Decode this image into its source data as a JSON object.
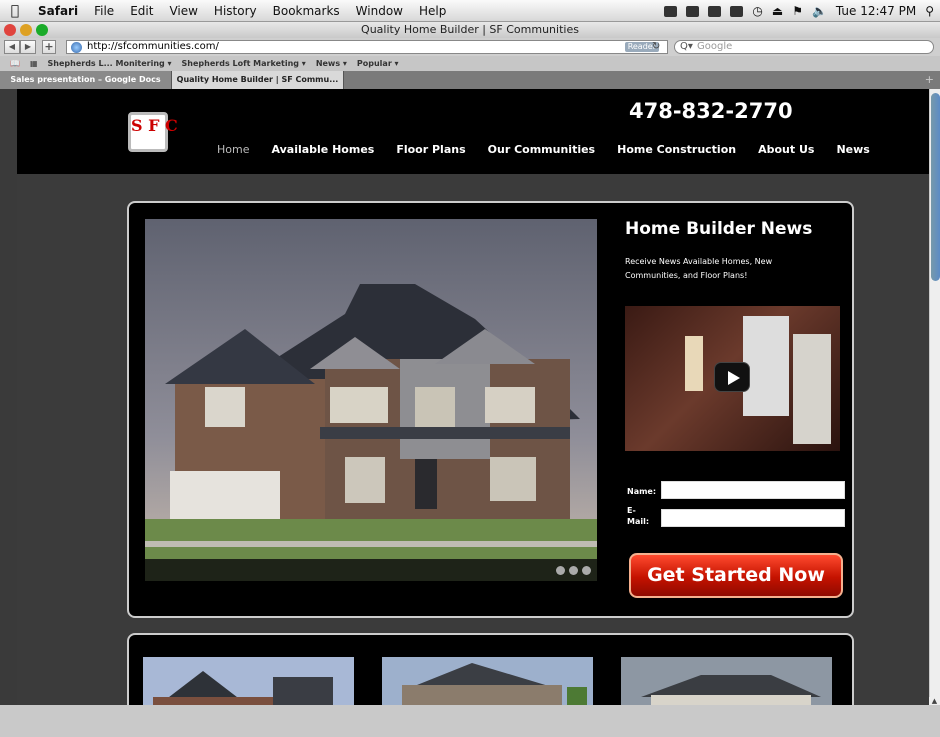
{
  "menubar": {
    "app": "Safari",
    "items": [
      "File",
      "Edit",
      "View",
      "History",
      "Bookmarks",
      "Window",
      "Help"
    ],
    "clock": "Tue 12:47 PM"
  },
  "window": {
    "title": "Quality Home Builder | SF Communities"
  },
  "toolbar": {
    "url": "http://sfcommunities.com/",
    "reader_label": "Reader",
    "search_placeholder": "Google"
  },
  "bookmarks": [
    "Shepherds L... Monitering ▾",
    "Shepherds Loft Marketing ▾",
    "News ▾",
    "Popular ▾"
  ],
  "tabs": [
    "Sales presentation – Google Docs",
    "Quality Home Builder | SF Commu..."
  ],
  "site": {
    "logo_text": "S F C",
    "phone": "478-832-2770",
    "nav": [
      "Home",
      "Available Homes",
      "Floor Plans",
      "Our Communities",
      "Home Construction",
      "About Us",
      "News"
    ],
    "news_title": "Home Builder News",
    "news_sub": "Receive News Available Homes, New Communities, and Floor Plans!",
    "name_label": "Name:",
    "email_label": "E-\nMail:",
    "cta": "Get Started Now"
  },
  "colors": {
    "cta": "#c41200",
    "background": "#3b3b3b",
    "header": "#000000"
  }
}
